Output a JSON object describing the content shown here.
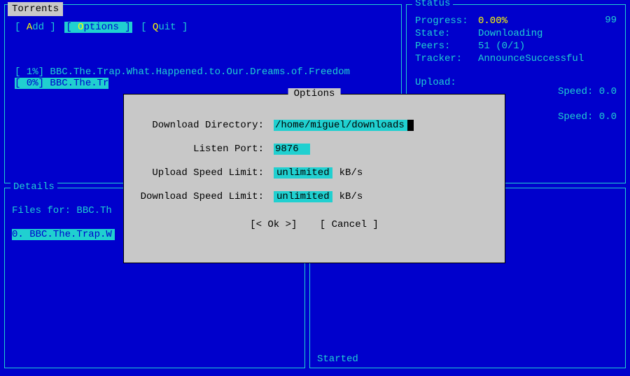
{
  "torrents": {
    "title": "Torrents",
    "menu": {
      "add": {
        "hotkey": "A",
        "rest": "dd"
      },
      "options": {
        "hotkey": "O",
        "rest": "ptions"
      },
      "quit": {
        "hotkey": "Q",
        "rest": "uit"
      }
    },
    "items": [
      {
        "pct": "[  1%]",
        "name": "BBC.The.Trap.What.Happened.to.Our.Dreams.of.Freedom"
      },
      {
        "pct": "[  0%]",
        "name": "BBC.The.Tr"
      }
    ]
  },
  "status": {
    "title": "Status",
    "progress_label": "Progress:",
    "progress_value": "0.00%",
    "number": "99",
    "state_label": "State:",
    "state_value": "Downloading",
    "peers_label": "Peers:",
    "peers_value": "51 (0/1)",
    "tracker_label": "Tracker:",
    "tracker_value": "AnnounceSuccessful",
    "upload_label": "Upload:",
    "speed1": "Speed: 0.0",
    "speed2": "Speed: 0.0"
  },
  "details": {
    "title": "Details",
    "files_for": "Files for: BBC.Th",
    "file0": "0. BBC.The.Trap.W"
  },
  "started": {
    "label": "Started"
  },
  "dialog": {
    "title": "Options",
    "dir_label": "Download Directory:",
    "dir_value": "/home/miguel/downloads",
    "port_label": "Listen Port:",
    "port_value": "9876",
    "upload_label": "Upload Speed Limit:",
    "upload_value": "unlimited",
    "download_label": "Download Speed Limit:",
    "download_value": "unlimited",
    "unit": "kB/s",
    "ok": "[< Ok >]",
    "cancel": "[ Cancel ]"
  }
}
